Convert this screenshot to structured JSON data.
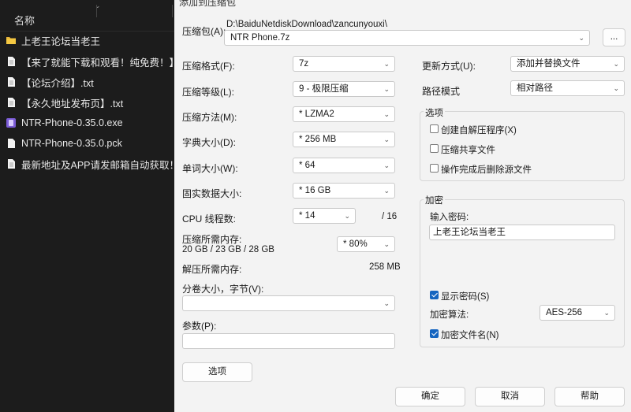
{
  "explorer": {
    "column_name": "名称",
    "files": [
      {
        "name": "上老王论坛当老王",
        "icon": "folder-icon"
      },
      {
        "name": "【来了就能下载和观看！纯免费！】.txt",
        "icon": "text-file-icon"
      },
      {
        "name": "【论坛介绍】.txt",
        "icon": "text-file-icon"
      },
      {
        "name": "【永久地址发布页】.txt",
        "icon": "text-file-icon"
      },
      {
        "name": "NTR-Phone-0.35.0.exe",
        "icon": "exe-file-icon"
      },
      {
        "name": "NTR-Phone-0.35.0.pck",
        "icon": "file-icon"
      },
      {
        "name": "最新地址及APP请发邮箱自动获取！！！",
        "icon": "text-file-icon"
      }
    ]
  },
  "dialog": {
    "title": "添加到压缩包",
    "archive_label": "压缩包(A):",
    "archive_path": "D:\\BaiduNetdiskDownload\\zancunyouxi\\",
    "archive_name": "NTR Phone.7z",
    "browse_label": "...",
    "format_label": "压缩格式(F):",
    "format_value": "7z",
    "level_label": "压缩等级(L):",
    "level_value": "9 - 极限压缩",
    "method_label": "压缩方法(M):",
    "method_value": "*  LZMA2",
    "dict_label": "字典大小(D):",
    "dict_value": "*  256 MB",
    "word_label": "单词大小(W):",
    "word_value": "*  64",
    "solid_label": "固实数据大小:",
    "solid_value": "*  16 GB",
    "cpu_label": "CPU 线程数:",
    "cpu_value": "*  14",
    "cpu_total": "/ 16",
    "mem_label": "压缩所需内存:",
    "mem_values": "20 GB / 23 GB / 28 GB",
    "mem_percent": "*  80%",
    "decomp_label": "解压所需内存:",
    "decomp_value": "258 MB",
    "split_label": "分卷大小，字节(V):",
    "split_value": "",
    "params_label": "参数(P):",
    "params_value": "",
    "options_button": "选项",
    "update_label": "更新方式(U):",
    "update_value": "添加并替换文件",
    "path_label": "路径模式",
    "path_value": "相对路径",
    "options_group": "选项",
    "opt_sfx": "创建自解压程序(X)",
    "opt_shared": "压缩共享文件",
    "opt_delete": "操作完成后删除源文件",
    "encrypt_group": "加密",
    "password_label": "输入密码:",
    "password_value": "上老王论坛当老王",
    "show_password": "显示密码(S)",
    "enc_method_label": "加密算法:",
    "enc_method_value": "AES-256",
    "encrypt_names": "加密文件名(N)",
    "ok_button": "确定",
    "cancel_button": "取消",
    "help_button": "帮助"
  }
}
